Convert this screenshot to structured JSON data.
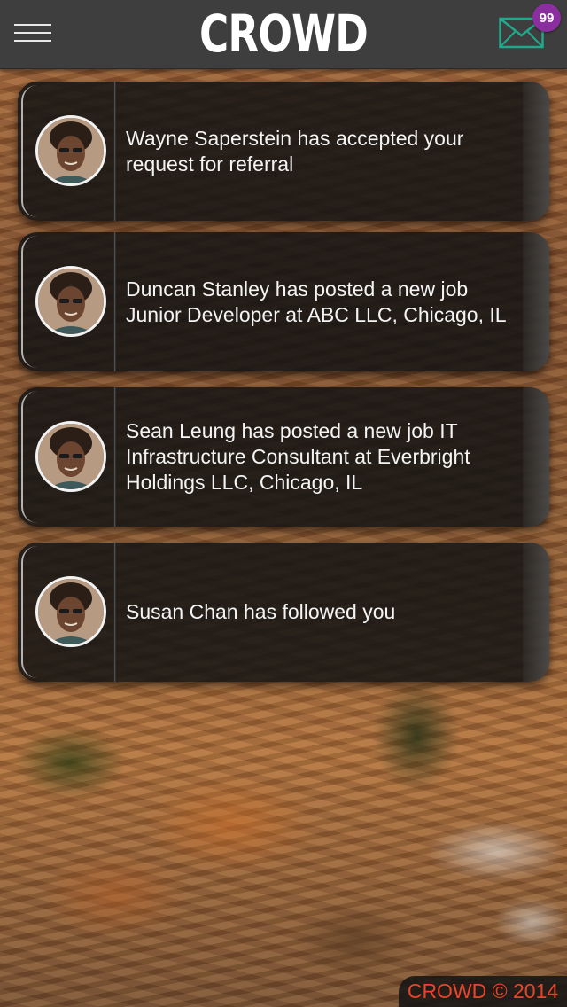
{
  "header": {
    "title": "CROWD",
    "menu_icon": "hamburger-menu-icon",
    "mail_icon": "envelope-icon",
    "mail_badge_count": "99",
    "mail_icon_color": "#1fa98a",
    "badge_color": "#8b2fa0"
  },
  "notifications": [
    {
      "text": "Wayne Saperstein has accepted your request for referral"
    },
    {
      "text": "Duncan Stanley has posted a new job Junior Developer at ABC LLC, Chicago, IL"
    },
    {
      "text": "Sean Leung has posted a new job IT Infrastructure Consultant at Everbright Holdings LLC, Chicago, IL"
    },
    {
      "text": "Susan Chan has followed you"
    }
  ],
  "footer": {
    "copyright": "CROWD © 2014",
    "text_color": "#e8452a"
  }
}
